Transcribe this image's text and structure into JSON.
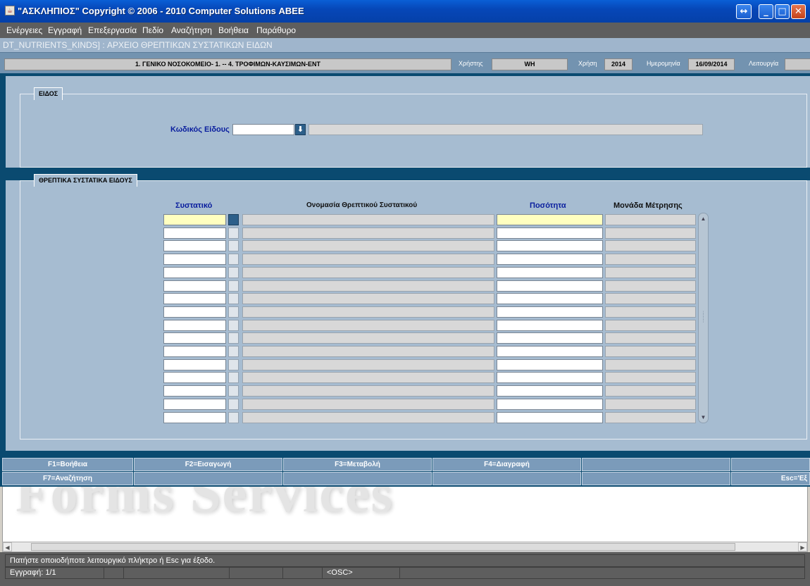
{
  "window": {
    "title": "\"ΑΣΚΛΗΠΙΟΣ\" Copyright © 2006 - 2010 Computer Solutions ΑΒΕΕ",
    "app_icon": "java-cup-icon",
    "controls": [
      "resize-arrows-icon",
      "minimize-icon",
      "maximize-icon",
      "close-icon"
    ]
  },
  "menu": [
    "Ενέργειες",
    "Εγγραφή",
    "Επεξεργασία",
    "Πεδίο",
    "Αναζήτηση",
    "Βοήθεια",
    "Παράθυρο"
  ],
  "form_subtitle": "DT_NUTRIENTS_KINDS]   :   ΑΡΧΕΙΟ ΘΡΕΠΤΙΚΩΝ ΣΥΣΤΑΤΙΚΩΝ ΕΙΔΩΝ",
  "info": {
    "organization": "1. ΓΕΝΙΚΟ ΝΟΣΟΚΟΜΕΙΟ- 1. -- 4. ΤΡΟΦΙΜΩΝ-ΚΑΥΣΙΜΩΝ-ΕΝΤ",
    "user_label": "Χρήστης",
    "user_value": "WH",
    "year_label": "Χρήση",
    "year_value": "2014",
    "date_label": "Ημερομηνία",
    "date_value": "16/09/2014",
    "function_label": "Λειτουργία",
    "function_value": ""
  },
  "item_section": {
    "title": "ΕΙΔΟΣ",
    "code_label": "Κωδικός Είδους",
    "code_value": "",
    "description_value": ""
  },
  "nutrients_section": {
    "title": "ΘΡΕΠΤΙΚΑ ΣΥΣΤΑΤΙΚΑ ΕΙΔΟΥΣ",
    "columns": {
      "component": "Συστατικό",
      "name": "Ονομασία Θρεπτικού Συστατικού",
      "quantity": "Ποσότητα",
      "unit": "Μονάδα Μέτρησης"
    },
    "row_count": 16,
    "rows": []
  },
  "function_keys": {
    "row1": [
      "F1=Βοήθεια",
      "F2=Εισαγωγή",
      "F3=Μεταβολή",
      "F4=Διαγραφή",
      "",
      ""
    ],
    "row2": [
      "F7=Αναζήτηση",
      "",
      "",
      "",
      "",
      "Esc='Εξ"
    ]
  },
  "watermark": "Forms Services",
  "status": {
    "message": "Πατήστε οποιοδήποτε λειτουργικό πλήκτρο ή Esc για έξοδο.",
    "record": "Εγγραφή: 1/1",
    "osc": "<OSC>"
  }
}
